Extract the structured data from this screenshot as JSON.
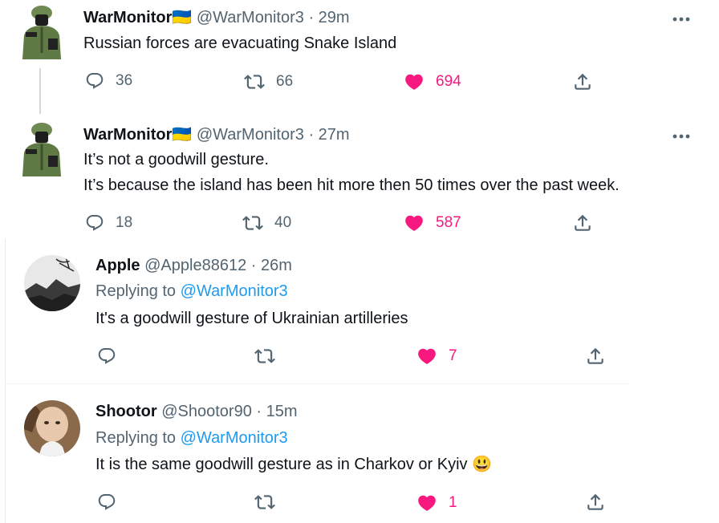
{
  "tweets": [
    {
      "name": "WarMonitor",
      "flag": "🇺🇦",
      "handle": "@WarMonitor3",
      "time": "· 29m",
      "lines": [
        "Russian forces are evacuating Snake Island"
      ],
      "reply_count": "36",
      "retweet_count": "66",
      "like_count": "694"
    },
    {
      "name": "WarMonitor",
      "flag": "🇺🇦",
      "handle": "@WarMonitor3",
      "time": "· 27m",
      "lines": [
        "It’s not a goodwill gesture.",
        "It’s because the island has been hit more then 50 times over the past week."
      ],
      "reply_count": "18",
      "retweet_count": "40",
      "like_count": "587"
    },
    {
      "name": "Apple",
      "handle": "@Apple88612",
      "time": "· 26m",
      "replying_prefix": "Replying to",
      "replying_to": "@WarMonitor3",
      "lines": [
        "It's a goodwill gesture of Ukrainian artilleries"
      ],
      "reply_count": "",
      "retweet_count": "",
      "like_count": "7"
    },
    {
      "name": "Shootor",
      "handle": "@Shootor90",
      "time": "· 15m",
      "replying_prefix": "Replying to",
      "replying_to": "@WarMonitor3",
      "lines": [
        "It is the same goodwill gesture as in Charkov or Kyiv"
      ],
      "emoji": "😃",
      "reply_count": "",
      "retweet_count": "",
      "like_count": "1"
    }
  ],
  "colors": {
    "like": "#f91880",
    "mention": "#1d9bf0",
    "secondary": "#536471"
  },
  "icons": [
    "reply-icon",
    "retweet-icon",
    "like-icon",
    "share-icon",
    "more-icon"
  ]
}
